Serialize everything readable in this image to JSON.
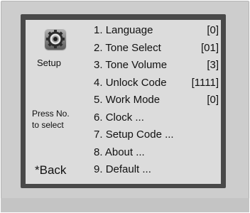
{
  "side": {
    "icon": "gear-icon",
    "title": "Setup",
    "hint_line1": "Press No.",
    "hint_line2": "to select",
    "back_label": "*Back"
  },
  "menu": {
    "items": [
      {
        "num": "1.",
        "label": "Language",
        "value": "[0]"
      },
      {
        "num": "2.",
        "label": "Tone Select",
        "value": "[01]"
      },
      {
        "num": "3.",
        "label": "Tone Volume",
        "value": "[3]"
      },
      {
        "num": "4.",
        "label": "Unlock Code",
        "value": "[1111]"
      },
      {
        "num": "5.",
        "label": "Work Mode",
        "value": "[0]"
      },
      {
        "num": "6.",
        "label": "Clock ...",
        "value": ""
      },
      {
        "num": "7.",
        "label": "Setup Code ...",
        "value": ""
      },
      {
        "num": "8.",
        "label": "About ...",
        "value": ""
      },
      {
        "num": "9.",
        "label": "Default ...",
        "value": ""
      }
    ]
  },
  "colors": {
    "bezel": "#cdcdcd",
    "frame": "#494949",
    "screen": "#dcdcdc",
    "text": "#111111"
  }
}
